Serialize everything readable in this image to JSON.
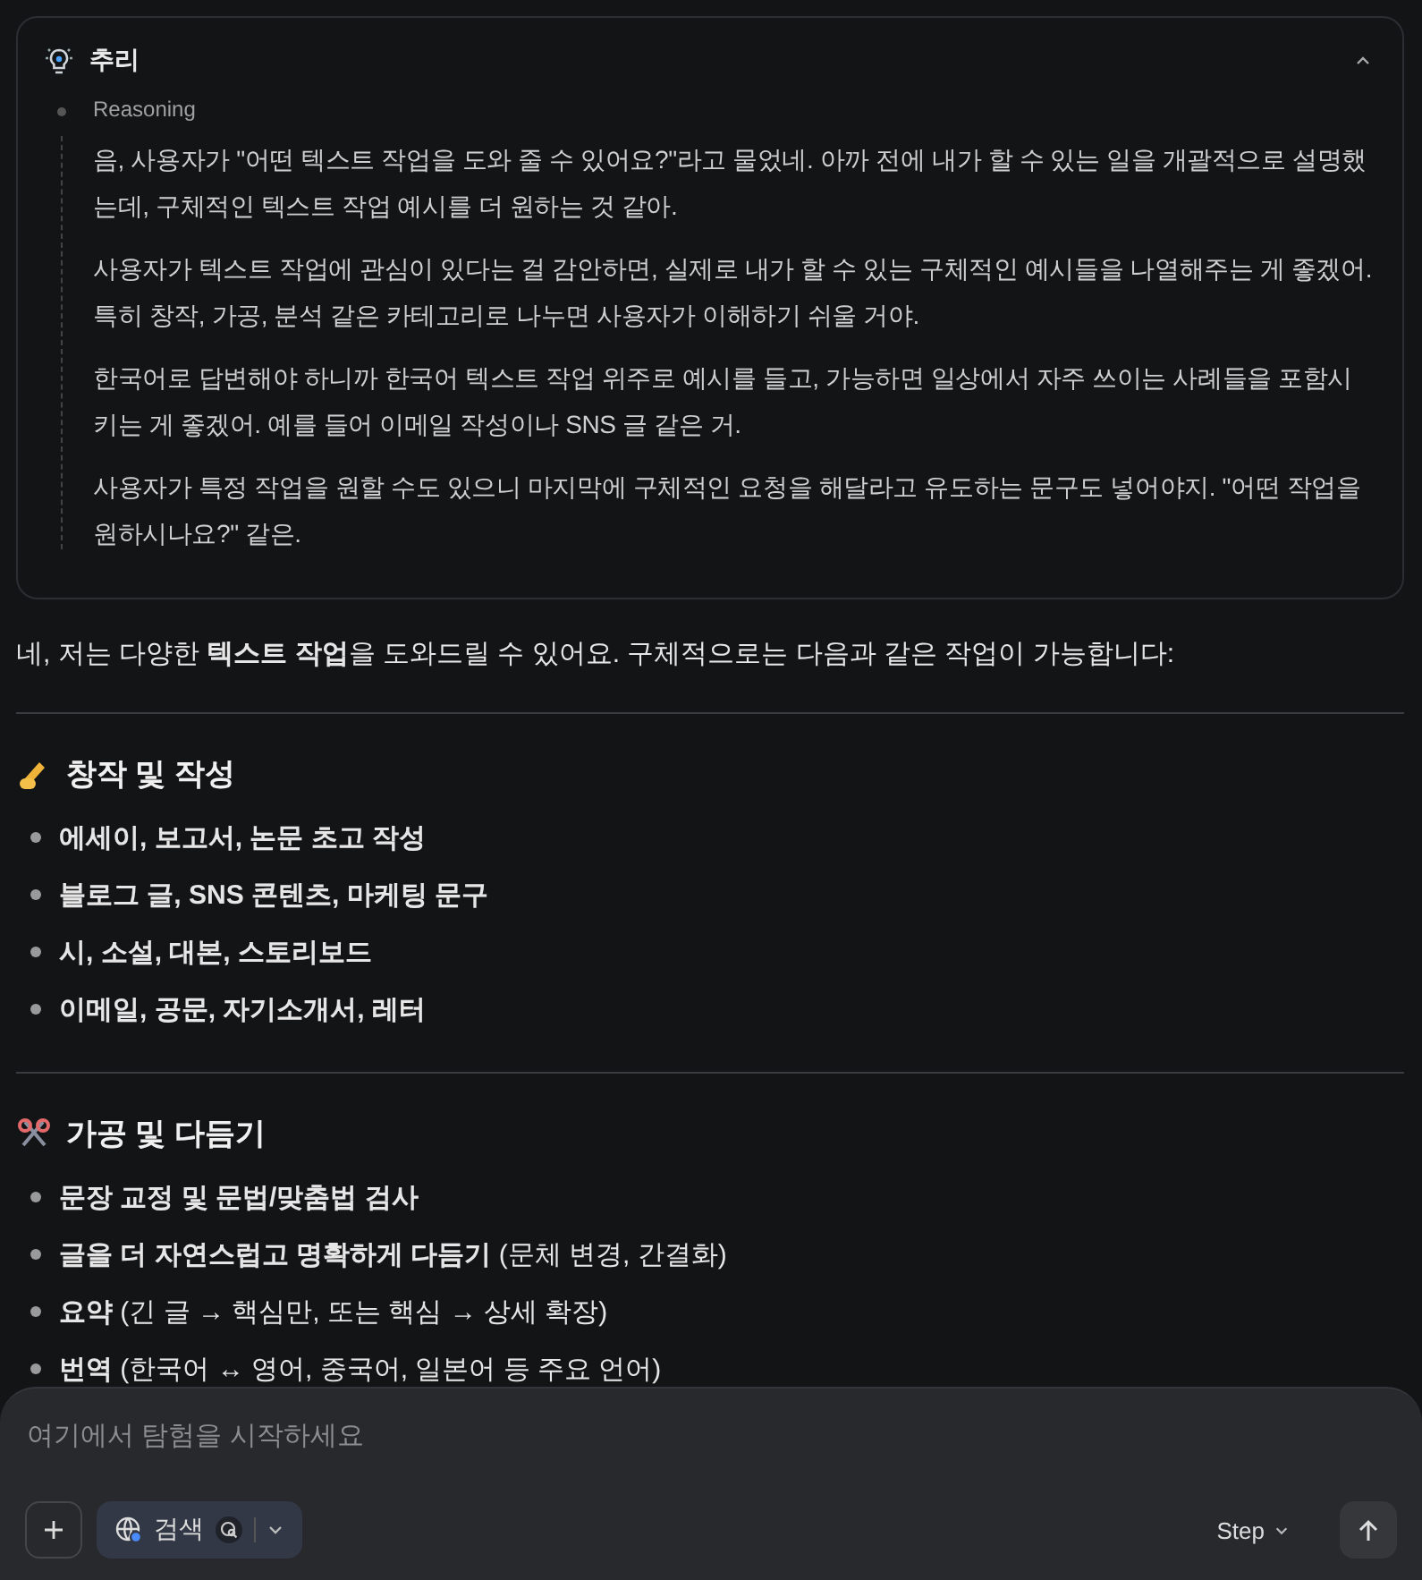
{
  "reasoning": {
    "title": "추리",
    "expanded": true,
    "step_label": "Reasoning",
    "paragraphs": [
      "음, 사용자가 \"어떤 텍스트 작업을 도와 줄 수 있어요?\"라고 물었네. 아까 전에 내가 할 수 있는 일을 개괄적으로 설명했는데, 구체적인 텍스트 작업 예시를 더 원하는 것 같아.",
      "사용자가 텍스트 작업에 관심이 있다는 걸 감안하면, 실제로 내가 할 수 있는 구체적인 예시들을 나열해주는 게 좋겠어. 특히 창작, 가공, 분석 같은 카테고리로 나누면 사용자가 이해하기 쉬울 거야.",
      "한국어로 답변해야 하니까 한국어 텍스트 작업 위주로 예시를 들고, 가능하면 일상에서 자주 쓰이는 사례들을 포함시키는 게 좋겠어. 예를 들어 이메일 작성이나 SNS 글 같은 거.",
      "사용자가 특정 작업을 원할 수도 있으니 마지막에 구체적인 요청을 해달라고 유도하는 문구도 넣어야지. \"어떤 작업을 원하시나요?\" 같은."
    ]
  },
  "answer": {
    "intro": "네, 저는 다양한 **텍스트 작업**을 도와드릴 수 있어요. 구체적으로는 다음과 같은 작업이 가능합니다:",
    "sections": [
      {
        "kind": "writing",
        "heading": "창작 및 작성",
        "bold_items": true,
        "items": [
          "에세이, 보고서, 논문 초고 작성",
          "블로그 글, SNS 콘텐츠, 마케팅 문구",
          "시, 소설, 대본, 스토리보드",
          "이메일, 공문, 자기소개서, 레터"
        ]
      },
      {
        "kind": "editing",
        "heading": "가공 및 다듬기",
        "bold_items": false,
        "items": [
          "**문장 교정 및 문법/맞춤법 검사**",
          "**글을 더 자연스럽고 명확하게 다듬기** (문체 변경, 간결화)",
          "**요약** (긴 글 → 핵심만, 또는 핵심 → 상세 확장)",
          "**번역** (한국어 ↔ 영어, 중국어, 일본어 등 주요 언어)"
        ]
      }
    ]
  },
  "composer": {
    "placeholder": "여기에서 탐험을 시작하세요",
    "search_label": "검색",
    "model_label": "Step"
  }
}
